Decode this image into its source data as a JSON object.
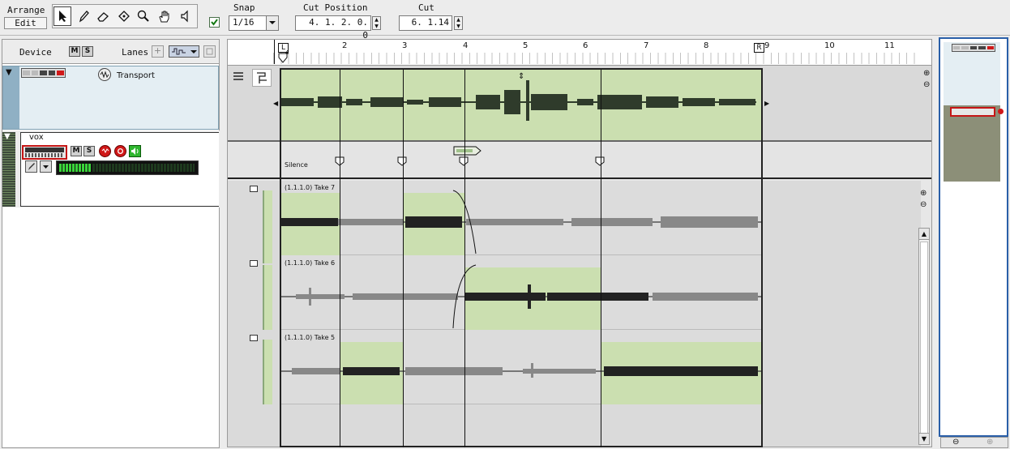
{
  "toolbar": {
    "arrange_label": "Arrange",
    "edit_label": "Edit",
    "snap_label": "Snap",
    "snap_value": "1/16",
    "cut_position_label": "Cut Position",
    "cut_position_value": "4. 1. 2.  0. 0",
    "cut_label": "Cut",
    "cut_value": "6.  1.14",
    "tools": [
      "arrow-icon",
      "pencil-icon",
      "eraser-icon",
      "razor-icon",
      "magnify-icon",
      "hand-icon",
      "speaker-icon"
    ]
  },
  "track_list": {
    "device_label": "Device",
    "lanes_label": "Lanes",
    "transport_name": "Transport",
    "vox_name": "vox",
    "mute_label": "M",
    "solo_label": "S"
  },
  "ruler": {
    "marks": [
      "2",
      "3",
      "4",
      "5",
      "6",
      "7",
      "8",
      "9",
      "10",
      "11"
    ],
    "loop_left": "L",
    "loop_right": "R",
    "pos_start": "4"
  },
  "comp": {
    "silence_label": "Silence",
    "takes": [
      "(1.1.1.0) Take 7",
      "(1.1.1.0) Take 6",
      "(1.1.1.0) Take 5"
    ]
  },
  "colors": {
    "selected_take": "#cbdfb0",
    "waveform": "#2f3b2b",
    "meter": "#3ad43a",
    "record": "#d01818",
    "track_blue": "#8fb0c4"
  }
}
